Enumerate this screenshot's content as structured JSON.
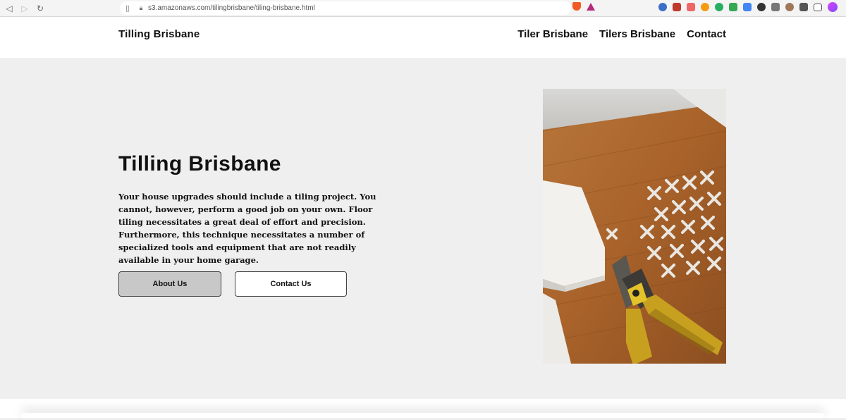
{
  "browser": {
    "url": "s3.amazonaws.com/tilingbrisbane/tiling-brisbane.html"
  },
  "header": {
    "logo": "Tilling Brisbane",
    "nav": [
      {
        "label": "Tiler Brisbane"
      },
      {
        "label": "Tilers Brisbane"
      },
      {
        "label": "Contact"
      }
    ]
  },
  "hero": {
    "title": "Tilling Brisbane",
    "text": "Your house upgrades should include a tiling project. You cannot, however, perform a good job on your own. Floor tiling necessitates a great deal of effort and precision. Furthermore, this technique necessitates a number of specialized tools and equipment that are not readily available in your home garage.",
    "about_label": "About Us",
    "contact_label": "Contact Us"
  },
  "colors": {
    "page_bg": "#efefef",
    "header_bg": "#ffffff",
    "about_button_bg": "#c8c8c8",
    "text": "#111111"
  }
}
